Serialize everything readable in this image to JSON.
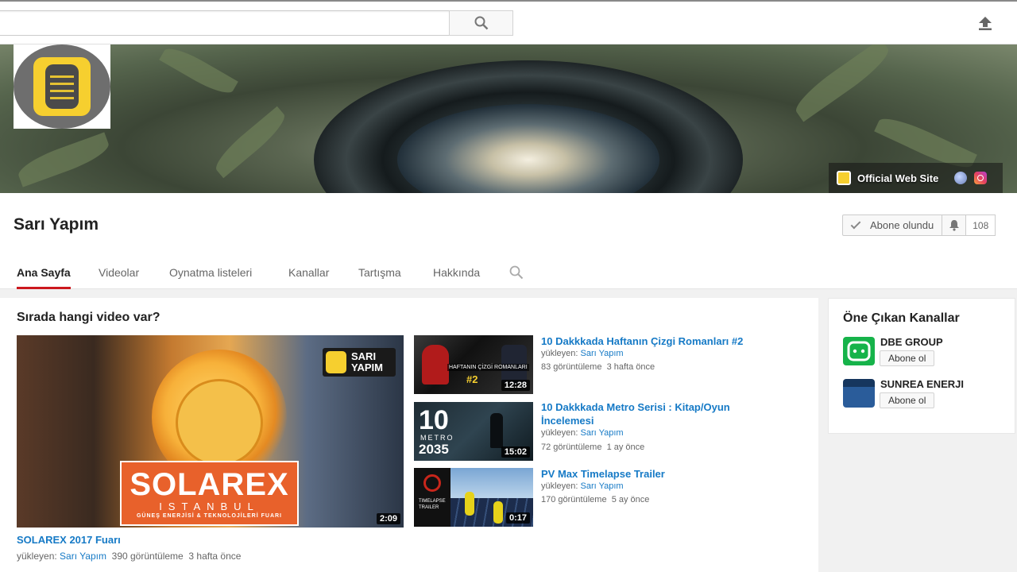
{
  "topbar": {
    "search_placeholder": "",
    "search_icon": "search-icon",
    "upload_icon": "upload-icon"
  },
  "banner": {
    "link_label": "Official Web Site",
    "social_icons": [
      "globe-icon",
      "instagram-icon"
    ]
  },
  "channel": {
    "name": "Sarı Yapım",
    "subscribe_label": "Abone olundu",
    "subscriber_count": "108"
  },
  "tabs": [
    {
      "label": "Ana Sayfa",
      "active": true
    },
    {
      "label": "Videolar",
      "active": false
    },
    {
      "label": "Oynatma listeleri",
      "active": false
    },
    {
      "label": "Kanallar",
      "active": false
    },
    {
      "label": "Tartışma",
      "active": false
    },
    {
      "label": "Hakkında",
      "active": false
    }
  ],
  "section": {
    "title": "Sırada hangi video var?"
  },
  "featured": {
    "duration": "2:09",
    "title": "SOLAREX 2017 Fuarı",
    "uploader_prefix": "yükleyen:",
    "uploader": "Sarı Yapım",
    "views": "390 görüntüleme",
    "age": "3 hafta önce",
    "thumb_text": {
      "brand": "SOLAREX",
      "city": "ISTANBUL",
      "subtitle": "GÜNEŞ ENERJİSİ & TEKNOLOJİLERİ FUARI",
      "logo_line1": "SARI",
      "logo_line2": "YAPIM"
    }
  },
  "videos": [
    {
      "title": "10 Dakkkada Haftanın Çizgi Romanları #2",
      "uploader_prefix": "yükleyen:",
      "uploader": "Sarı Yapım",
      "views": "83 görüntüleme",
      "age": "3 hafta önce",
      "duration": "12:28",
      "thumb_text": "HAFTANIN ÇİZGİ ROMANLARI",
      "thumb_num": "#2"
    },
    {
      "title": "10 Dakkkada Metro Serisi : Kitap/Oyun İncelemesi",
      "uploader_prefix": "yükleyen:",
      "uploader": "Sarı Yapım",
      "views": "72 görüntüleme",
      "age": "1 ay önce",
      "duration": "15:02",
      "thumb_big": "10",
      "thumb_metro": "METRO",
      "thumb_year": "2035"
    },
    {
      "title": "PV Max Timelapse Trailer",
      "uploader_prefix": "yükleyen:",
      "uploader": "Sarı Yapım",
      "views": "170 görüntüleme",
      "age": "5 ay önce",
      "duration": "0:17",
      "thumb_text": "TIMELAPSE TRAILER"
    }
  ],
  "sidebar": {
    "title": "Öne Çıkan Kanallar",
    "channels": [
      {
        "name": "DBE GROUP",
        "button": "Abone ol",
        "color": "#16b34a"
      },
      {
        "name": "SUNREA ENERJI",
        "button": "Abone ol",
        "color": "#2a5c9a"
      }
    ]
  },
  "colors": {
    "accent_red": "#cc181e",
    "link_blue": "#167ac6",
    "brand_yellow": "#f6cf2f"
  }
}
